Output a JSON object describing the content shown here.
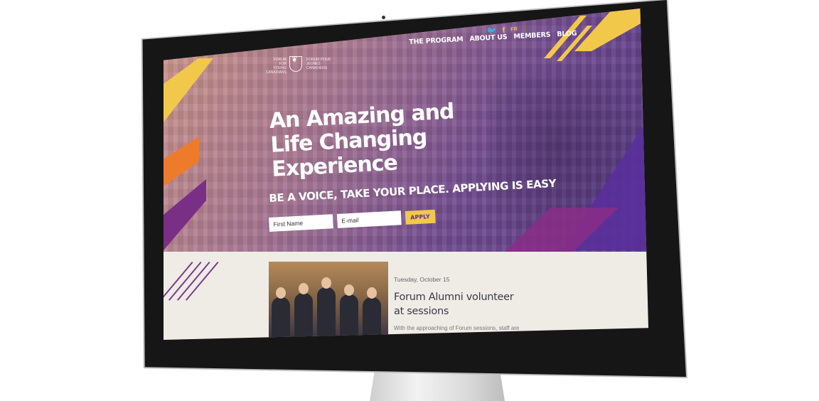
{
  "header": {
    "logo_en": "FORUM FOR YOUNG CANADIANS",
    "logo_fr": "FORUM POUR JEUNES CANADIENS",
    "nav": [
      "THE PROGRAM",
      "ABOUT US",
      "MEMBERS",
      "BLOG"
    ],
    "social": {
      "twitter_icon": "twitter-icon",
      "facebook_icon": "facebook-icon",
      "lang_toggle": "FR"
    }
  },
  "hero": {
    "headline": "An Amazing and Life Changing Experience",
    "tagline": "BE A VOICE, TAKE YOUR PLACE.  APPLYING IS EASY",
    "first_name_placeholder": "First Name",
    "email_placeholder": "E-mail",
    "apply_label": "APPLY"
  },
  "news": {
    "date": "Tuesday, October 15",
    "title": "Forum Alumni volunteer at sessions",
    "excerpt": "With the approaching of Forum sessions, staff are"
  },
  "colors": {
    "yellow": "#f2c84b",
    "orange": "#ee7b2c",
    "purple": "#5a2f9b",
    "magenta": "#8a2d87"
  }
}
